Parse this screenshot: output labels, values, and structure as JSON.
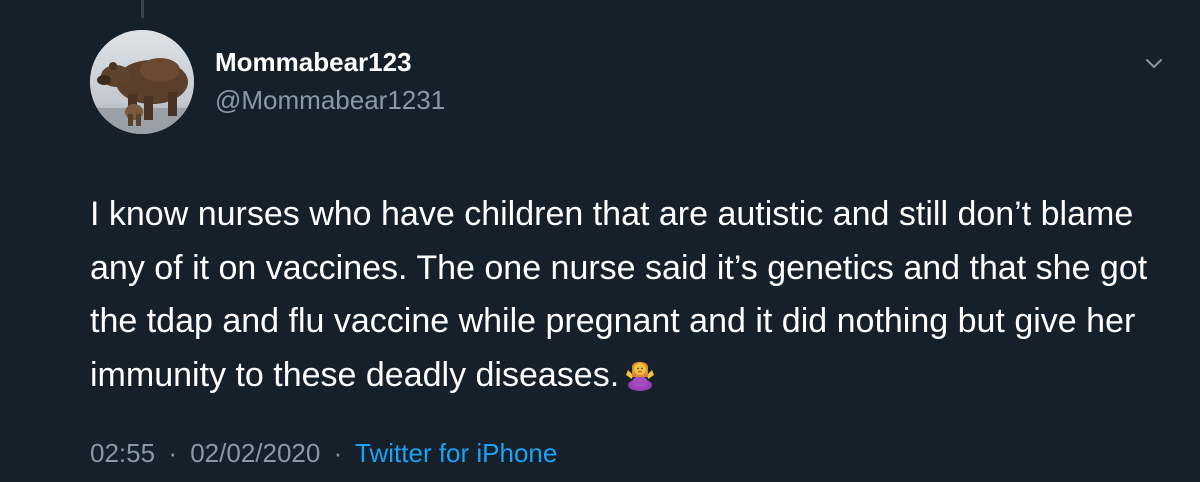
{
  "user": {
    "display_name": "Mommabear123",
    "handle": "@Mommabear1231",
    "avatar": "bear-avatar-icon"
  },
  "tweet": {
    "text": "I know nurses who have children that are autistic and still don’t blame any of it on vaccines. The one nurse said it’s genetics and that she got the tdap and flu vaccine while pregnant and it did nothing but give her immunity to these deadly diseases.",
    "emoji": "person-shrugging-emoji"
  },
  "meta": {
    "time": "02:55",
    "date": "02/02/2020",
    "separator": "·",
    "source": "Twitter for iPhone"
  },
  "icons": {
    "more_menu": "chevron-down-icon"
  },
  "colors": {
    "background": "#15202b",
    "primary_text": "#ffffff",
    "secondary_text": "#8899a6",
    "link": "#1da1f2"
  }
}
